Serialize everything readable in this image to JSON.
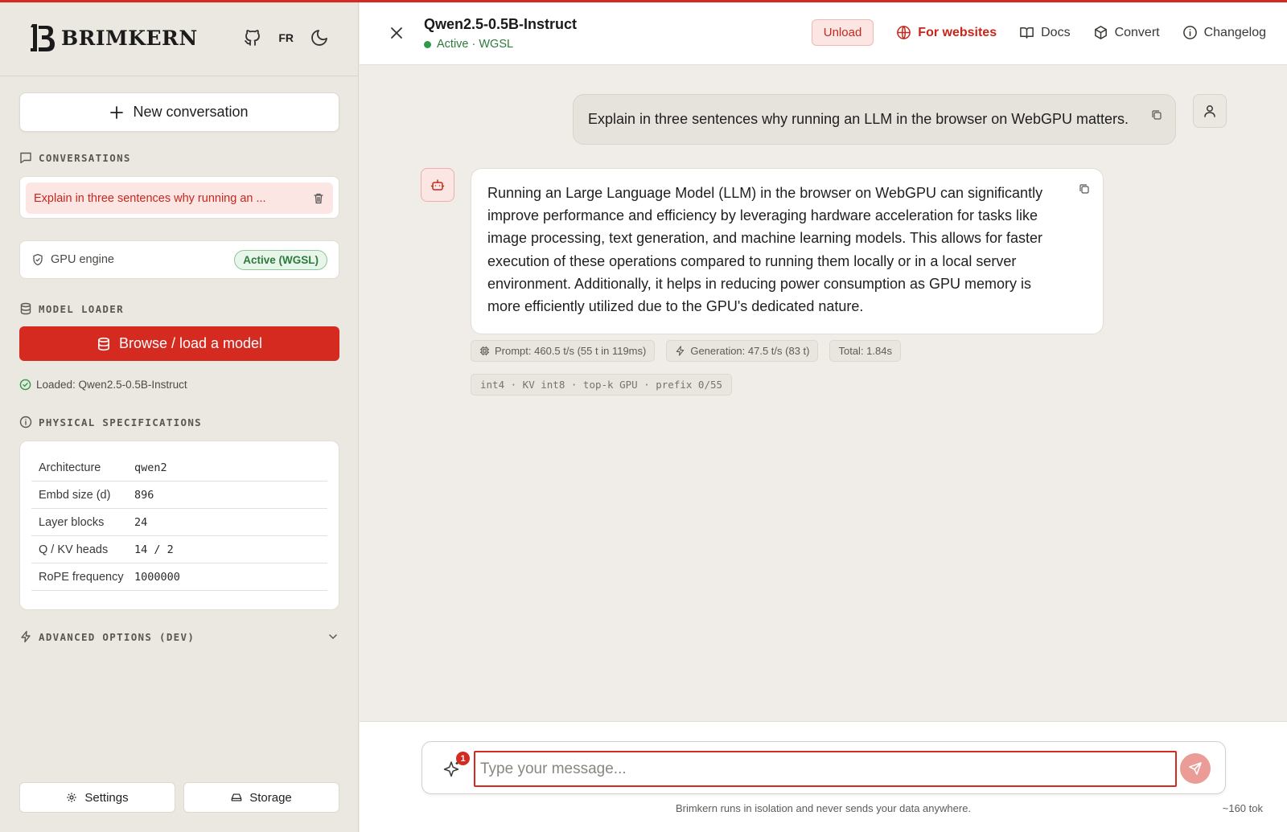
{
  "brand": {
    "name": "BRIMKERN",
    "lang": "FR"
  },
  "sidebar": {
    "new_conversation": "New conversation",
    "conversations_title": "CONVERSATIONS",
    "conversations": [
      {
        "label": "Explain in three sentences why running an ..."
      }
    ],
    "gpu": {
      "label": "GPU engine",
      "badge": "Active (WGSL)"
    },
    "model_loader_title": "MODEL LOADER",
    "browse_button": "Browse / load a model",
    "loaded_text": "Loaded: Qwen2.5-0.5B-Instruct",
    "specs_title": "PHYSICAL SPECIFICATIONS",
    "specs": [
      {
        "k": "Architecture",
        "v": "qwen2"
      },
      {
        "k": "Embd size (d)",
        "v": "896"
      },
      {
        "k": "Layer blocks",
        "v": "24"
      },
      {
        "k": "Q / KV heads",
        "v": "14 / 2"
      },
      {
        "k": "RoPE frequency",
        "v": "1000000"
      }
    ],
    "advanced_title": "ADVANCED OPTIONS (DEV)",
    "settings_button": "Settings",
    "storage_button": "Storage"
  },
  "header": {
    "model_name": "Qwen2.5-0.5B-Instruct",
    "status": "Active · WGSL",
    "unload": "Unload",
    "for_websites": "For websites",
    "docs": "Docs",
    "convert": "Convert",
    "changelog": "Changelog"
  },
  "chat": {
    "user_message": "Explain in three sentences why running an LLM in the browser on WebGPU matters.",
    "assistant_message": "Running an Large Language Model (LLM) in the browser on WebGPU can significantly improve performance and efficiency by leveraging hardware acceleration for tasks like image processing, text generation, and machine learning models. This allows for faster execution of these operations compared to running them locally or in a local server environment. Additionally, it helps in reducing power consumption as GPU memory is more efficiently utilized due to the GPU's dedicated nature.",
    "stats": {
      "prompt": "Prompt: 460.5 t/s (55 t in 119ms)",
      "generation": "Generation: 47.5 t/s (83 t)",
      "total": "Total: 1.84s"
    },
    "tags": "int4 · KV int8 · top-k GPU · prefix 0/55"
  },
  "composer": {
    "placeholder": "Type your message...",
    "badge_count": "1",
    "footnote": "Brimkern runs in isolation and never sends your data anywhere.",
    "token_estimate": "~160 tok"
  },
  "colors": {
    "accent": "#d42a20",
    "success": "#2c7a3c",
    "background": "#f0ede8"
  }
}
